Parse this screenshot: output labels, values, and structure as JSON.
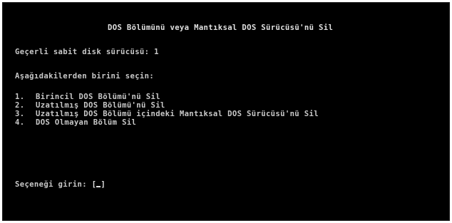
{
  "screen": {
    "title": "DOS Bölümünü veya Mantıksal DOS Sürücüsü'nü Sil",
    "current_drive_label": "Geçerli sabit disk sürücüsü:",
    "current_drive_value": "1",
    "instruction": "Aşağıdakilerden birini seçin:",
    "menu": [
      {
        "number": "1.",
        "label": "Birincil DOS Bölümü'nü Sil"
      },
      {
        "number": "2.",
        "label": "Uzatılmış DOS Bölümü'nü Sil"
      },
      {
        "number": "3.",
        "label": "Uzatılmış DOS Bölümü içindeki Mantıksal DOS Sürücüsü'nü Sil"
      },
      {
        "number": "4.",
        "label": "DOS Olmayan Bölüm Sil"
      }
    ],
    "prompt_label": "Seçeneği girin:",
    "prompt_open": "[",
    "prompt_close": "]"
  },
  "colors": {
    "background": "#000000",
    "text": "#c8c8c8",
    "highlight": "#e0e0e0"
  }
}
